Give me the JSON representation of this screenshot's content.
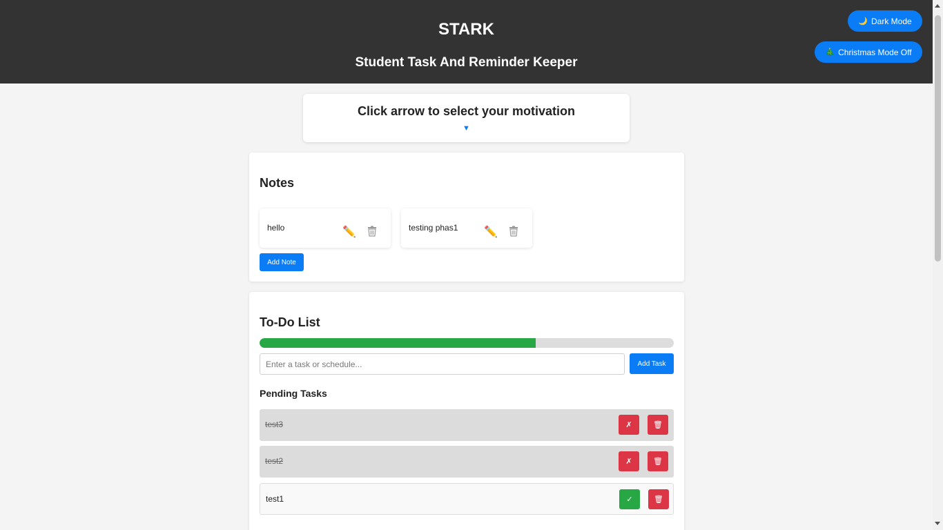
{
  "header": {
    "title": "STARK",
    "subtitle": "Student Task And Reminder Keeper",
    "dark_mode_label": "Dark Mode",
    "christmas_mode_label": "Christmas Mode Off"
  },
  "motivation": {
    "prompt": "Click arrow to select your motivation",
    "arrow": "▼"
  },
  "notes": {
    "title": "Notes",
    "items": [
      {
        "text": "hello"
      },
      {
        "text": "testing phas1"
      }
    ],
    "add_label": "Add Note"
  },
  "todo": {
    "title": "To-Do List",
    "progress_fraction": 0.667,
    "input_placeholder": "Enter a task or schedule...",
    "add_label": "Add Task",
    "pending_title": "Pending Tasks",
    "tasks": [
      {
        "text": "test3",
        "completed": true,
        "toggle_symbol": "✗",
        "delete_symbol": "🗑"
      },
      {
        "text": "test2",
        "completed": true,
        "toggle_symbol": "✗",
        "delete_symbol": "🗑"
      },
      {
        "text": "test1",
        "completed": false,
        "toggle_symbol": "✓",
        "delete_symbol": "🗑"
      }
    ]
  },
  "colors": {
    "header_bg": "#333333",
    "accent": "#0a7cf5",
    "success": "#28a745",
    "danger": "#dc3545"
  },
  "icons": {
    "dark_mode": "moon-icon",
    "christmas_mode": "christmas-tree-icon",
    "note_edit": "pencil-icon",
    "note_delete": "trash-icon"
  }
}
